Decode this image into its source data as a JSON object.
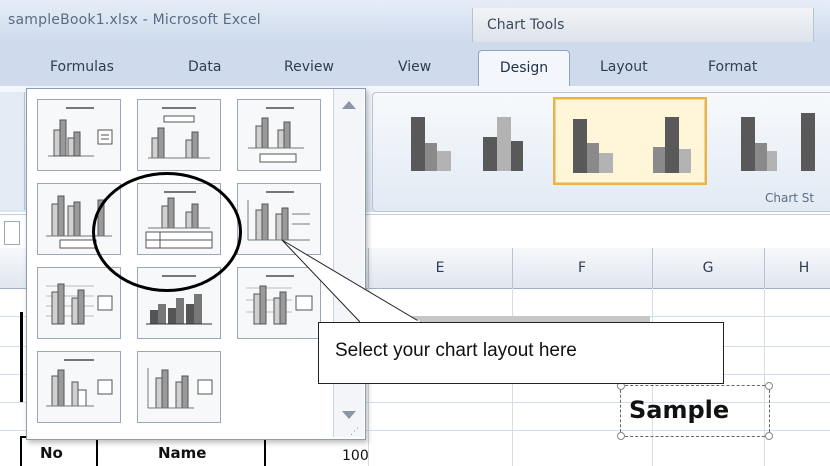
{
  "window": {
    "title": "sampleBook1.xlsx - Microsoft Excel",
    "context_tab_group": "Chart Tools"
  },
  "tabs": [
    {
      "label": "Formulas"
    },
    {
      "label": "Data"
    },
    {
      "label": "Review"
    },
    {
      "label": "View"
    },
    {
      "label": "Design",
      "active": true
    },
    {
      "label": "Layout"
    },
    {
      "label": "Format"
    }
  ],
  "ribbon": {
    "chart_styles_label": "Chart St"
  },
  "columns": [
    "E",
    "F",
    "G",
    "H"
  ],
  "gallery": {
    "rows": 4,
    "items": 11,
    "highlighted_index": 4
  },
  "callout": {
    "text": "Select your chart layout here"
  },
  "sheet": {
    "sample_title": "Sample",
    "table_headers": [
      "No",
      "Name"
    ],
    "axis_value": "100"
  },
  "colors": {
    "accent": "#e5b44a",
    "bar_dark": "#595959",
    "bar_mid": "#8a8a8a",
    "bar_light": "#b3b3b3"
  }
}
